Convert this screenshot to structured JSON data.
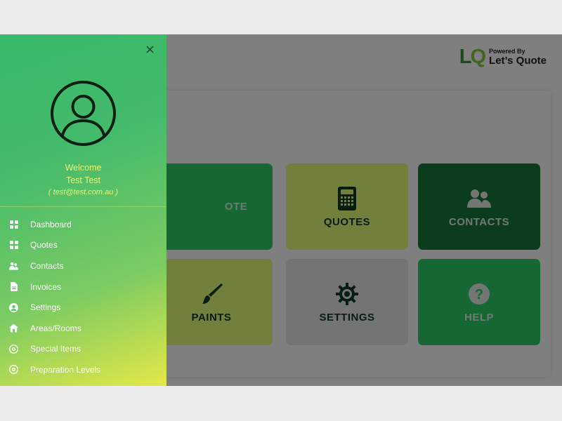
{
  "brand": {
    "logo_mark_l": "L",
    "logo_mark_q": "Q",
    "powered_by": "Powered By",
    "name": "Let’s Quote"
  },
  "drawer": {
    "welcome": "Welcome",
    "user_name": "Test Test",
    "email": "test@test.com.au",
    "menu": [
      {
        "label": "Dashboard",
        "icon": "grid-icon"
      },
      {
        "label": "Quotes",
        "icon": "grid-icon"
      },
      {
        "label": "Contacts",
        "icon": "users-icon"
      },
      {
        "label": "Invoices",
        "icon": "file-icon"
      },
      {
        "label": "Settings",
        "icon": "user-circle-icon"
      },
      {
        "label": "Areas/Rooms",
        "icon": "house-icon"
      },
      {
        "label": "Special Items",
        "icon": "gear-circle-icon"
      },
      {
        "label": "Preparation Levels",
        "icon": "gear-circle-icon"
      }
    ]
  },
  "tiles": [
    {
      "label": "OTE",
      "icon": "none"
    },
    {
      "label": "QUOTES",
      "icon": "calculator-icon"
    },
    {
      "label": "CONTACTS",
      "icon": "users-icon"
    },
    {
      "label": "PAINTS",
      "icon": "paintbrush-icon"
    },
    {
      "label": "SETTINGS",
      "icon": "gear-icon"
    },
    {
      "label": "HELP",
      "icon": "question-icon"
    }
  ],
  "colors": {
    "drawer_top": "#37b86a",
    "drawer_bottom": "#e3e84a",
    "accent_text": "#e8f77a",
    "tile_green": "#2ad166",
    "tile_lime": "#e6ff7a",
    "tile_dark": "#17793a",
    "tile_gray": "#e9e9e9"
  }
}
